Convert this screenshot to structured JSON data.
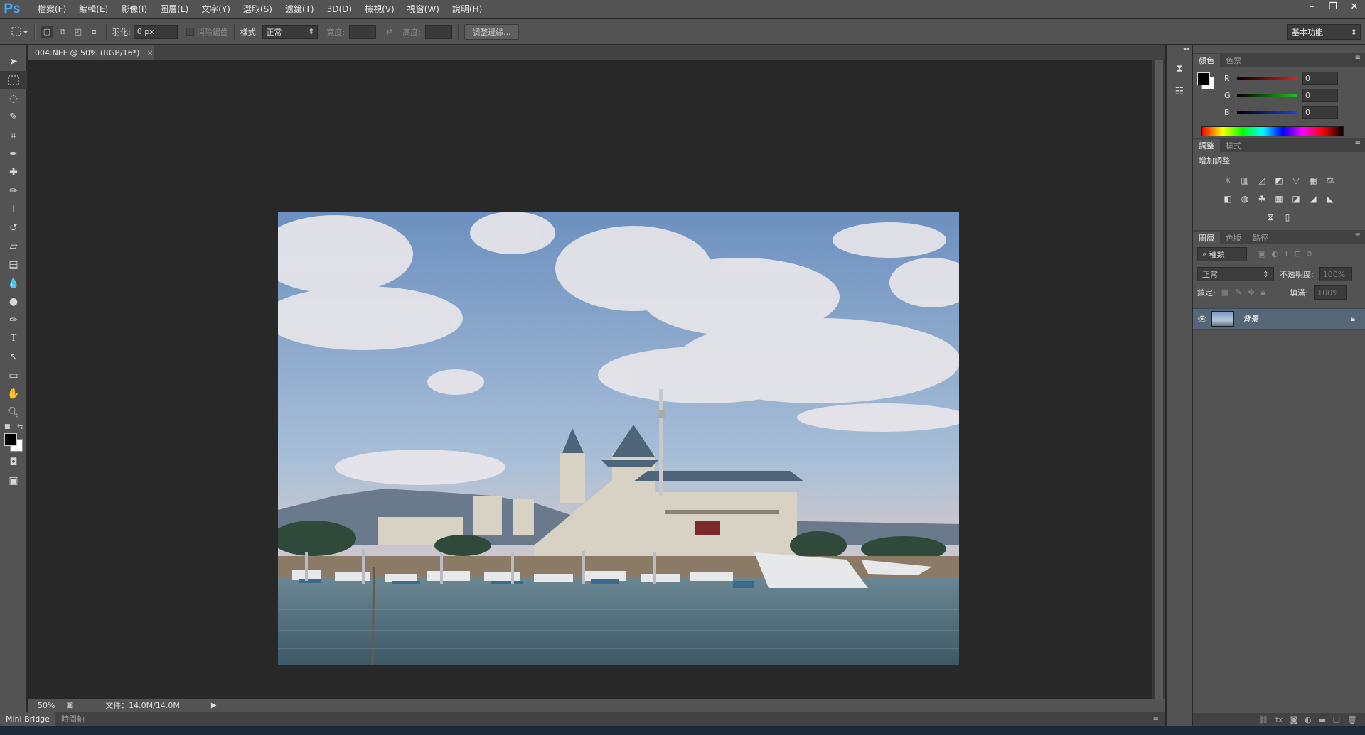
{
  "app": {
    "logo": "Ps"
  },
  "menu": [
    "檔案(F)",
    "編輯(E)",
    "影像(I)",
    "圖層(L)",
    "文字(Y)",
    "選取(S)",
    "濾鏡(T)",
    "3D(D)",
    "檢視(V)",
    "視窗(W)",
    "說明(H)"
  ],
  "window_controls": {
    "minimize": "–",
    "restore": "❐",
    "close": "✕"
  },
  "options": {
    "feather_label": "羽化:",
    "feather_value": "0 px",
    "antialias_label": "消除鋸齒",
    "style_label": "樣式:",
    "style_value": "正常",
    "width_label": "寬度:",
    "height_label": "高度:",
    "refine_button": "調整邊緣...",
    "workspace": "基本功能"
  },
  "document": {
    "tab_title": "004.NEF @ 50% (RGB/16*)",
    "close": "×"
  },
  "status": {
    "zoom": "50%",
    "doc_info": "文件：14.0M/14.0M"
  },
  "bottom_tabs": [
    "Mini Bridge",
    "時間軸"
  ],
  "color_panel": {
    "tabs": [
      "顏色",
      "色票"
    ],
    "channels": [
      {
        "name": "R",
        "value": "0",
        "color": "#e02020"
      },
      {
        "name": "G",
        "value": "0",
        "color": "#20c020"
      },
      {
        "name": "B",
        "value": "0",
        "color": "#2040e0"
      }
    ]
  },
  "adjust_panel": {
    "tabs": [
      "調整",
      "樣式"
    ],
    "title": "增加調整"
  },
  "layers_panel": {
    "tabs": [
      "圖層",
      "色版",
      "路徑"
    ],
    "filter": "種類",
    "blend": "正常",
    "opacity_label": "不透明度:",
    "opacity_value": "100%",
    "lock_label": "鎖定:",
    "fill_label": "填滿:",
    "fill_value": "100%",
    "layer_name": "背景"
  },
  "colors": {
    "accent": "#4da6ff",
    "bg": "#282828",
    "panel": "#535353"
  }
}
